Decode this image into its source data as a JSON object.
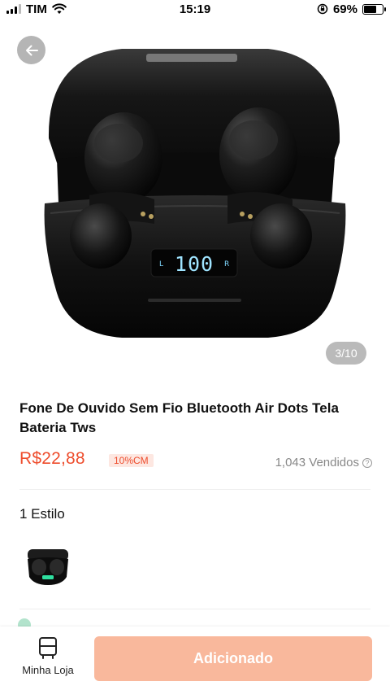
{
  "status_bar": {
    "carrier": "TIM",
    "time": "15:19",
    "battery_percent": "69%",
    "battery_level": 0.69
  },
  "gallery": {
    "counter": "3/10",
    "display_text": "100",
    "display_left": "L",
    "display_right": "R"
  },
  "product": {
    "title": "Fone De Ouvido Sem Fio Bluetooth Air Dots Tela Bateria Tws",
    "price": "R$22,88",
    "discount_badge": "10%CM",
    "sold": "1,043 Vendidos",
    "info_symbol": "?"
  },
  "variants": {
    "title": "1 Estilo"
  },
  "bottom_bar": {
    "store_label": "Minha Loja",
    "add_button_label": "Adicionado"
  },
  "colors": {
    "accent": "#ee4d2d",
    "button_disabled": "#f9b89c"
  }
}
